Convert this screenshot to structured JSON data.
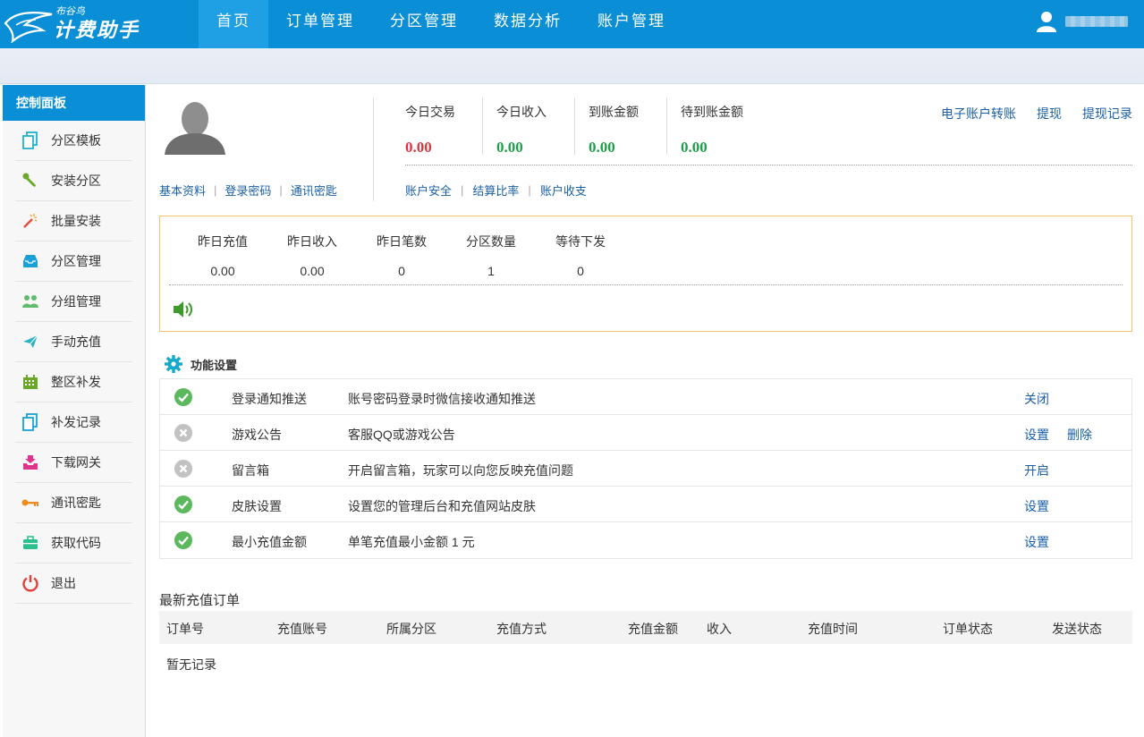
{
  "header": {
    "logo_small": "布谷鸟",
    "logo_main": "计费助手",
    "nav": [
      {
        "label": "首页",
        "active": true
      },
      {
        "label": "订单管理"
      },
      {
        "label": "分区管理"
      },
      {
        "label": "数据分析"
      },
      {
        "label": "账户管理"
      }
    ]
  },
  "sidebar": {
    "title": "控制面板",
    "items": [
      {
        "label": "分区模板",
        "icon": "copy-icon"
      },
      {
        "label": "安装分区",
        "icon": "wrench-icon"
      },
      {
        "label": "批量安装",
        "icon": "magic-wand-icon"
      },
      {
        "label": "分区管理",
        "icon": "inbox-icon"
      },
      {
        "label": "分组管理",
        "icon": "users-icon"
      },
      {
        "label": "手动充值",
        "icon": "paper-plane-icon"
      },
      {
        "label": "整区补发",
        "icon": "calendar-icon"
      },
      {
        "label": "补发记录",
        "icon": "copy-icon"
      },
      {
        "label": "下载网关",
        "icon": "download-tray-icon"
      },
      {
        "label": "通讯密匙",
        "icon": "key-icon"
      },
      {
        "label": "获取代码",
        "icon": "briefcase-icon"
      },
      {
        "label": "退出",
        "icon": "power-icon"
      }
    ]
  },
  "profile": {
    "links": [
      "基本资料",
      "登录密码",
      "通讯密匙"
    ]
  },
  "today": {
    "stats": [
      {
        "label": "今日交易",
        "value": "0.00",
        "color": "#d9363e"
      },
      {
        "label": "今日收入",
        "value": "0.00",
        "color": "#1e9e4a"
      },
      {
        "label": "到账金额",
        "value": "0.00",
        "color": "#1e9e4a"
      },
      {
        "label": "待到账金额",
        "value": "0.00",
        "color": "#1e9e4a"
      }
    ],
    "account_links": [
      "电子账户转账",
      "提现",
      "提现记录"
    ],
    "security_links": [
      "账户安全",
      "结算比率",
      "账户收支"
    ]
  },
  "yesterday": {
    "cols": [
      {
        "label": "昨日充值",
        "value": "0.00"
      },
      {
        "label": "昨日收入",
        "value": "0.00"
      },
      {
        "label": "昨日笔数",
        "value": "0"
      },
      {
        "label": "分区数量",
        "value": "1"
      },
      {
        "label": "等待下发",
        "value": "0"
      }
    ]
  },
  "functions": {
    "title": "功能设置",
    "rows": [
      {
        "status": "on",
        "name": "登录通知推送",
        "desc": "账号密码登录时微信接收通知推送",
        "actions": [
          "关闭"
        ]
      },
      {
        "status": "off",
        "name": "游戏公告",
        "desc": "客服QQ或游戏公告",
        "actions": [
          "设置",
          "删除"
        ]
      },
      {
        "status": "off",
        "name": "留言箱",
        "desc": "开启留言箱，玩家可以向您反映充值问题",
        "actions": [
          "开启"
        ]
      },
      {
        "status": "on",
        "name": "皮肤设置",
        "desc": "设置您的管理后台和充值网站皮肤",
        "actions": [
          "设置"
        ]
      },
      {
        "status": "on",
        "name": "最小充值金额",
        "desc": "单笔充值最小金额 1 元",
        "actions": [
          "设置"
        ]
      }
    ]
  },
  "orders": {
    "title": "最新充值订单",
    "columns": [
      "订单号",
      "充值账号",
      "所属分区",
      "充值方式",
      "充值金额",
      "收入",
      "充值时间",
      "订单状态",
      "发送状态"
    ],
    "empty": "暂无记录"
  },
  "colors": {
    "brand": "#0a8fd6",
    "link": "#1a5fa3",
    "highlight_border": "#f2c66e"
  }
}
